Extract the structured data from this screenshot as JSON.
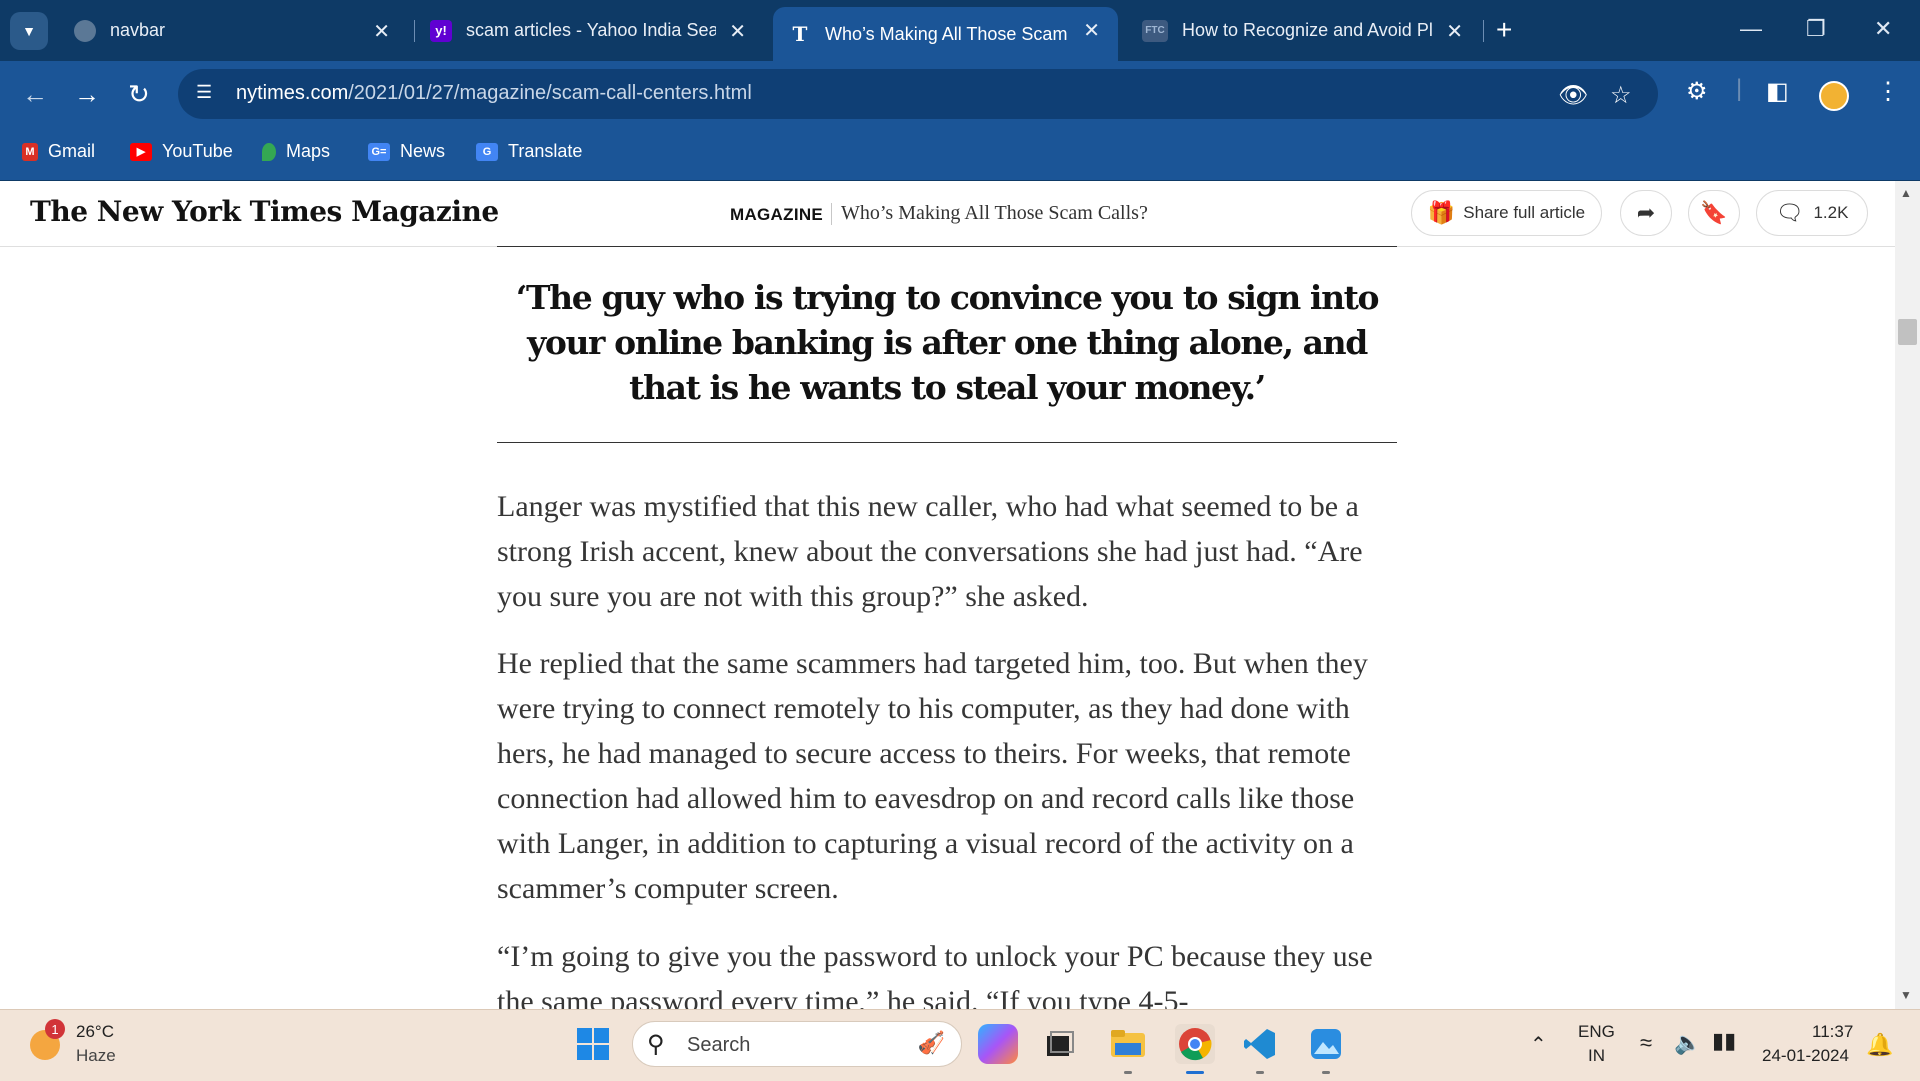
{
  "browser": {
    "tabs": [
      {
        "title": "navbar",
        "icon": "globe-icon",
        "active": false
      },
      {
        "title": "scam articles - Yahoo India Sear",
        "icon": "yahoo-icon",
        "active": false
      },
      {
        "title": "Who’s Making All Those Scam (",
        "icon": "nyt-icon",
        "active": true
      },
      {
        "title": "How to Recognize and Avoid Pl",
        "icon": "ftc-icon",
        "active": false
      }
    ],
    "url_host": "nytimes.com",
    "url_path": "/2021/01/27/magazine/scam-call-centers.html",
    "bookmarks": [
      {
        "label": "Gmail",
        "icon": "gmail-icon"
      },
      {
        "label": "YouTube",
        "icon": "youtube-icon"
      },
      {
        "label": "Maps",
        "icon": "maps-icon"
      },
      {
        "label": "News",
        "icon": "news-icon"
      },
      {
        "label": "Translate",
        "icon": "translate-icon"
      }
    ]
  },
  "header": {
    "logo": "The New York Times Magazine",
    "section": "MAGAZINE",
    "title": "Who’s Making All Those Scam Calls?",
    "share_label": "Share full article",
    "comment_count": "1.2K"
  },
  "article": {
    "pullquote": "‘The guy who is trying to convince you to sign into your online banking is after one thing alone, and that is he wants to steal your money.’",
    "paragraphs": [
      "Langer was mystified that this new caller, who had what seemed to be a strong Irish accent, knew about the conversations she had just had. “Are you sure you are not with this group?” she asked.",
      "He replied that the same scammers had targeted him, too. But when they were trying to connect remotely to his computer, as they had done with hers, he had managed to secure access to theirs. For weeks, that remote connection had allowed him to eavesdrop on and record calls like those with Langer, in addition to capturing a visual record of the activity on a scammer’s computer screen.",
      "“I’m going to give you the password to unlock your PC because they use the same password every time,” he said. “If you type 4-5-"
    ]
  },
  "taskbar": {
    "weather_temp": "26°C",
    "weather_desc": "Haze",
    "weather_badge": "1",
    "search_placeholder": "Search",
    "lang_top": "ENG",
    "lang_bottom": "IN",
    "time": "11:37",
    "date": "24-01-2024"
  },
  "colors": {
    "tabstrip": "#0e3a66",
    "toolbar": "#1b5597",
    "taskbar": "#f2e4d8"
  }
}
